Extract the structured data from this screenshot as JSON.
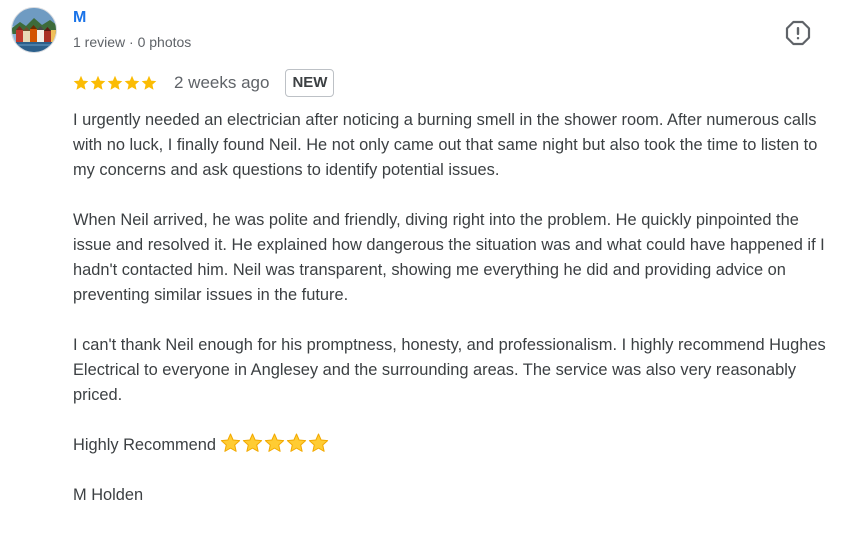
{
  "author": {
    "name": "M",
    "meta": "1 review · 0 photos"
  },
  "review": {
    "rating": 5,
    "rating_max": 5,
    "time": "2 weeks ago",
    "badge": "NEW",
    "paragraphs": [
      "I urgently needed an electrician after noticing a burning smell in the shower room. After numerous calls with no luck, I finally found Neil. He not only came out that same night but also took the time to listen to my concerns and ask questions to identify potential issues.",
      "When Neil arrived, he was polite and friendly, diving right into the problem. He quickly pinpointed the issue and resolved it. He explained how dangerous the situation was and what could have happened if I hadn't contacted him. Neil was transparent, showing me everything he did and providing advice on preventing similar issues in the future.",
      "I can't thank Neil enough for his promptness, honesty, and professionalism. I highly recommend Hughes Electrical to everyone in Anglesey and the surrounding areas. The service was also very reasonably priced."
    ],
    "closing": "Highly Recommend",
    "closing_emoji_count": 5,
    "signature": "M Holden"
  },
  "icons": {
    "report": "report-flag-icon",
    "star": "star-icon"
  },
  "colors": {
    "author_name": "#1a73e8",
    "star": "#fbbc04",
    "emoji_star": "#ffcc33"
  }
}
